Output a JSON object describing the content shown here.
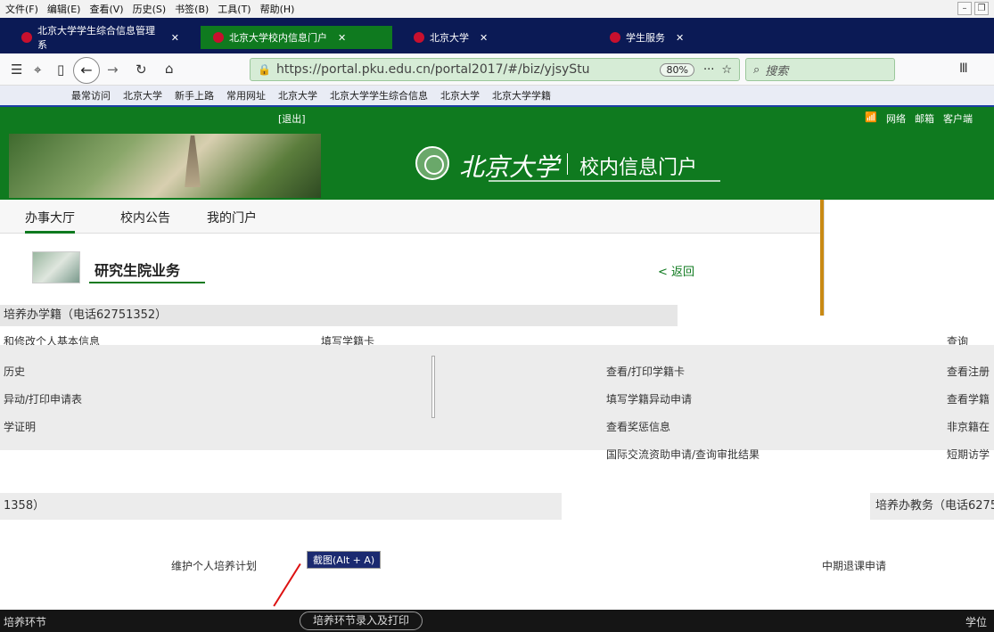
{
  "menubar": {
    "items": [
      "文件(F)",
      "编辑(E)",
      "查看(V)",
      "历史(S)",
      "书签(B)",
      "工具(T)",
      "帮助(H)"
    ]
  },
  "tabs": [
    {
      "label": "北京大学学生综合信息管理系"
    },
    {
      "label": "北京大学校内信息门户"
    },
    {
      "label": "北京大学"
    },
    {
      "label": "学生服务"
    }
  ],
  "navbar": {
    "url": "https://portal.pku.edu.cn/portal2017/#/biz/yjsyStu",
    "zoom": "80%",
    "more": "···",
    "search_placeholder": "搜索"
  },
  "bookmarks": [
    "最常访问",
    "北京大学",
    "新手上路",
    "常用网址",
    "北京大学",
    "北京大学学生综合信息",
    "北京大学",
    "北京大学学籍"
  ],
  "portal": {
    "logout": "[退出]",
    "top_links": [
      "网络",
      "邮箱",
      "客户端"
    ],
    "logo_text": "北京大学",
    "subtitle": "校内信息门户",
    "nav_tabs": [
      "办事大厅",
      "校内公告",
      "我的门户"
    ],
    "section_title": "研究生院业务",
    "back": "< 返回",
    "group1_header": "培养办学籍（电话62751352）",
    "group1_items": {
      "col1": [
        "和修改个人基本信息",
        "历史",
        "异动/打印申请表",
        "学证明"
      ],
      "col2": [
        "填写学籍卡"
      ],
      "col3": [
        "查看/打印学籍卡",
        "填写学籍异动申请",
        "查看奖惩信息",
        "国际交流资助申请/查询审批结果"
      ],
      "col4": [
        "查看注册",
        "查看学籍",
        "非京籍在",
        "短期访学"
      ],
      "right_top": "查询"
    },
    "group2_header_left": "1358）",
    "group2_header_right": "培养办教务（电话6275",
    "group2_items": {
      "plan": "维护个人培养计划",
      "midterm": "中期退课申请"
    },
    "screenshot_hint": "截图(Alt + A)",
    "footer": {
      "left": "培养环节",
      "middle": "培养环节录入及打印",
      "right": "学位"
    }
  }
}
